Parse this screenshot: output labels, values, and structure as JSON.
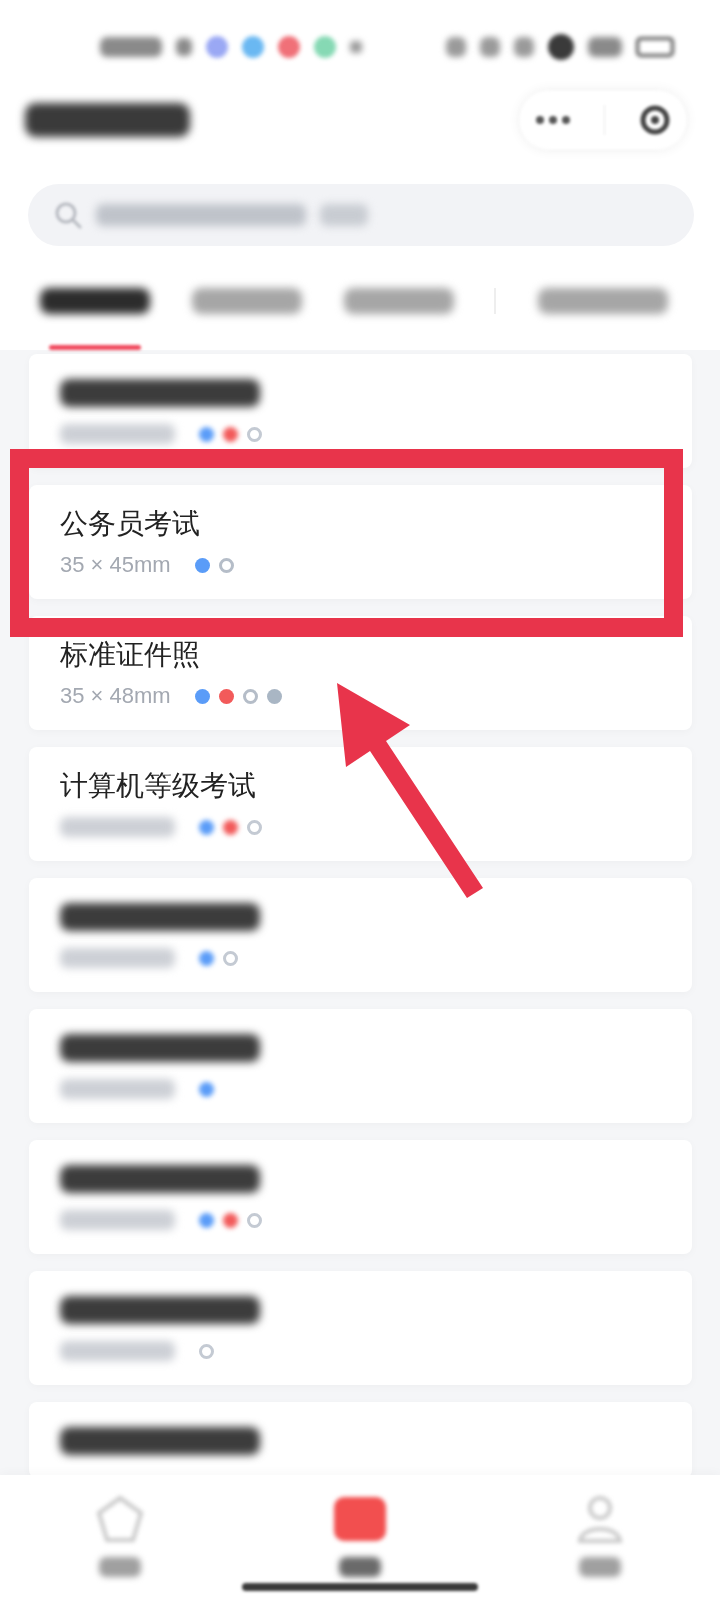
{
  "status_bar": {
    "notification_icons": [
      {
        "color": "#9aa8f4"
      },
      {
        "color": "#6ab8f2"
      },
      {
        "color": "#f07078"
      },
      {
        "color": "#86d9b4"
      }
    ]
  },
  "tabs": [
    {
      "selected": true
    },
    {
      "selected": false
    },
    {
      "selected": false
    },
    {
      "selected": false
    }
  ],
  "items": [
    {
      "highlighted": false,
      "blurred": true,
      "dots": [
        {
          "color": "#5a9cf8",
          "kind": "filled"
        },
        {
          "color": "#f25a5a",
          "kind": "filled"
        },
        {
          "color": "#c4cad3",
          "kind": "ring"
        }
      ]
    },
    {
      "title": "公务员考试",
      "size": "35 × 45mm",
      "highlighted": true,
      "blurred": false,
      "dots": [
        {
          "color": "#5a9cf8",
          "kind": "filled"
        },
        {
          "color": "#b5bdc8",
          "kind": "ring"
        }
      ]
    },
    {
      "title": "标准证件照",
      "size": "35 × 48mm",
      "highlighted": false,
      "blurred": false,
      "dots": [
        {
          "color": "#5a9cf8",
          "kind": "filled"
        },
        {
          "color": "#f25a5a",
          "kind": "filled"
        },
        {
          "color": "#b5bdc8",
          "kind": "ring"
        },
        {
          "color": "#a9b6c4",
          "kind": "filled"
        }
      ]
    },
    {
      "title": "计算机等级考试",
      "highlighted": false,
      "blurred": true,
      "dots": [
        {
          "color": "#5a9cf8",
          "kind": "filled"
        },
        {
          "color": "#f25a5a",
          "kind": "filled"
        },
        {
          "color": "#c4cad3",
          "kind": "ring"
        }
      ]
    },
    {
      "highlighted": false,
      "blurred": true,
      "dots": [
        {
          "color": "#5a9cf8",
          "kind": "filled"
        },
        {
          "color": "#c4cad3",
          "kind": "ring"
        }
      ]
    },
    {
      "highlighted": false,
      "blurred": true,
      "dots": [
        {
          "color": "#5a9cf8",
          "kind": "filled"
        }
      ]
    },
    {
      "highlighted": false,
      "blurred": true,
      "dots": [
        {
          "color": "#5a9cf8",
          "kind": "filled"
        },
        {
          "color": "#f25a5a",
          "kind": "filled"
        },
        {
          "color": "#c4cad3",
          "kind": "ring"
        }
      ]
    },
    {
      "highlighted": false,
      "blurred": true,
      "dots": [
        {
          "color": "#c4cad3",
          "kind": "ring"
        }
      ]
    },
    {
      "highlighted": false,
      "blurred": true
    }
  ],
  "bottom_nav": [
    {
      "selected": false
    },
    {
      "selected": true
    },
    {
      "selected": false
    }
  ]
}
